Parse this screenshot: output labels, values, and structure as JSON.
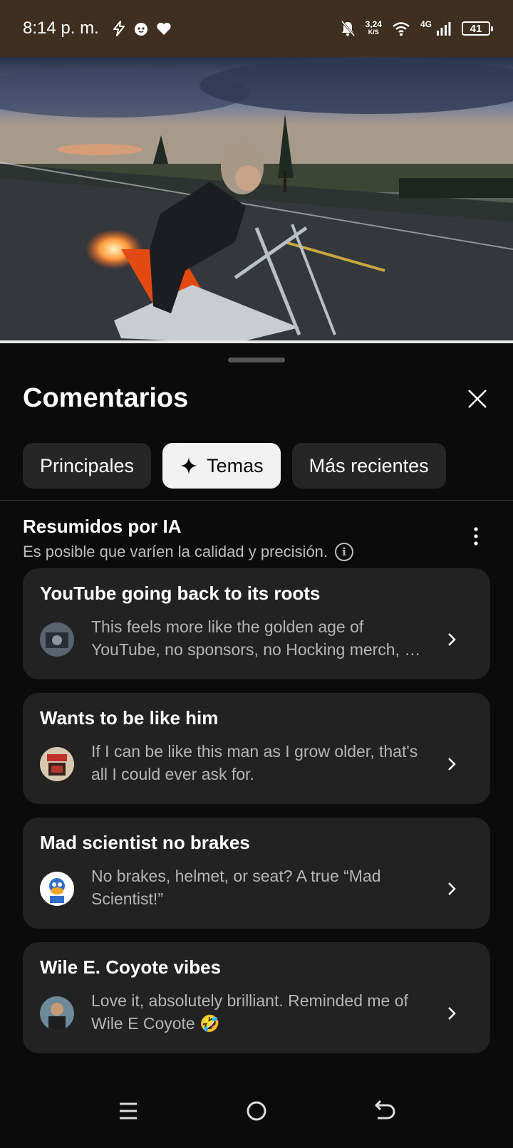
{
  "status_bar": {
    "time": "8:14 p. m.",
    "speed_value": "3,24",
    "speed_unit": "K/S",
    "network": "4G",
    "battery": "41"
  },
  "video": {
    "progress": 1.0
  },
  "comments": {
    "title": "Comentarios",
    "tabs": [
      {
        "label": "Principales",
        "active": false
      },
      {
        "label": "Temas",
        "active": true,
        "icon": "sparkle-icon"
      },
      {
        "label": "Más recientes",
        "active": false
      }
    ],
    "ai_summary": {
      "title": "Resumidos por IA",
      "subtitle": "Es posible que varíen la calidad y precisión."
    },
    "topics": [
      {
        "title": "YouTube going back to its roots",
        "text": "This feels more like the golden age of YouTube, no sponsors, no Hocking merch, no ads, just pure fun."
      },
      {
        "title": "Wants to be like him",
        "text": "If I can be like this man as I grow older, that's all I could ever ask for."
      },
      {
        "title": "Mad scientist no brakes",
        "text": "No brakes, helmet, or seat? A true “Mad Scientist!”"
      },
      {
        "title": "Wile E. Coyote vibes",
        "text": "Love it, absolutely brilliant. Reminded me of Wile E Coyote 🤣"
      }
    ]
  },
  "colors": {
    "status_bar_bg": "#3e2f20",
    "sheet_bg": "#0b0b0b",
    "card_bg": "#222222",
    "chip_bg": "#262626",
    "chip_active_bg": "#f2f2f2"
  }
}
